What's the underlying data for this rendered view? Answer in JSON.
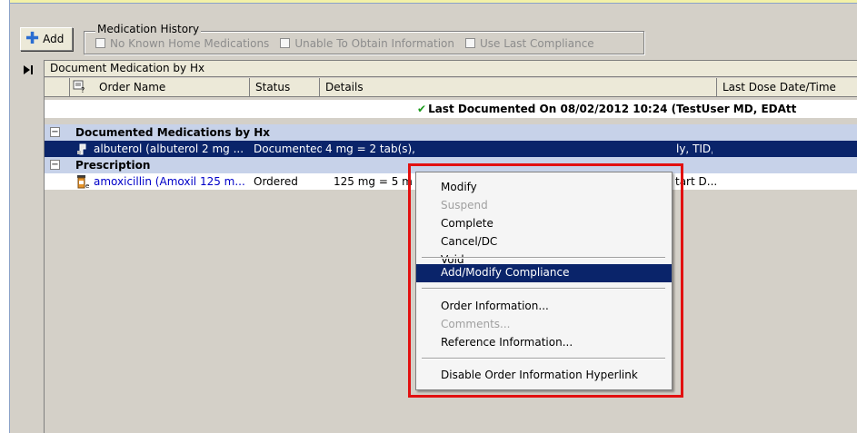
{
  "toolbar": {
    "add_label": "Add"
  },
  "medication_history": {
    "title": "Medication History",
    "options": [
      "No Known Home Medications",
      "Unable To Obtain Information",
      "Use Last Compliance"
    ]
  },
  "grid": {
    "caption": "Document Medication by Hx",
    "columns": [
      "Order Name",
      "Status",
      "Details",
      "Last Dose Date/Time"
    ],
    "last_documented": "Last Documented On 08/02/2012 10:24 (TestUser MD, EDAtt",
    "groups": [
      {
        "label": "Documented Medications by Hx",
        "rows": [
          {
            "order_name": "albuterol (albuterol 2 mg ...",
            "status": "Documented",
            "details": "4 mg = 2 tab(s), Ora",
            "details_tail": "ly, TID, 0 Refill(s), Start Date/Time: 08/02/...",
            "selected": true
          }
        ]
      },
      {
        "label": "Prescription",
        "rows": [
          {
            "order_name": "amoxicillin (Amoxil 125 m...",
            "status": "Ordered",
            "details": "125 mg = 5 m",
            "details_tail": "tart D...",
            "selected": false
          }
        ]
      }
    ]
  },
  "context_menu": {
    "items": [
      "Modify",
      "Suspend",
      "Complete",
      "Cancel/DC",
      "Void",
      "Add/Modify Compliance",
      "Order Information...",
      "Comments...",
      "Reference Information...",
      "Disable Order Information Hyperlink"
    ],
    "disabled": [
      "Suspend",
      "Comments..."
    ],
    "highlighted": "Add/Modify Compliance"
  },
  "colors": {
    "selection": "#0a246a",
    "highlight_box": "#e21010",
    "group_band": "#c7d2e9",
    "check": "#1a9a1a",
    "link": "#0000c8"
  }
}
